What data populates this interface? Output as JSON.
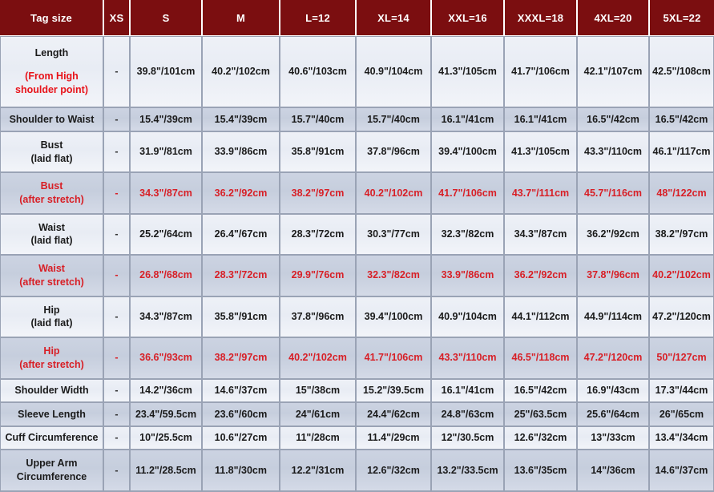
{
  "table": {
    "columns": [
      {
        "key": "label",
        "label": "Tag size"
      },
      {
        "key": "xs",
        "label": "XS"
      },
      {
        "key": "s",
        "label": "S"
      },
      {
        "key": "m",
        "label": "M"
      },
      {
        "key": "l",
        "label": "L=12"
      },
      {
        "key": "xl",
        "label": "XL=14"
      },
      {
        "key": "xxl",
        "label": "XXL=16"
      },
      {
        "key": "xxxl",
        "label": "XXXL=18"
      },
      {
        "key": "xxxxl",
        "label": "4XL=20"
      },
      {
        "key": "xxxxxl",
        "label": "5XL=22"
      }
    ],
    "rows": [
      {
        "label_main": "Length",
        "label_sub": "(From High shoulder point)",
        "label_sub_red": true,
        "stretch": false,
        "band": "light",
        "values": [
          "-",
          "39.8\"/101cm",
          "40.2\"/102cm",
          "40.6\"/103cm",
          "40.9\"/104cm",
          "41.3\"/105cm",
          "41.7\"/106cm",
          "42.1\"/107cm",
          "42.5\"/108cm"
        ]
      },
      {
        "label_main": "Shoulder to Waist",
        "label_sub": "",
        "label_sub_red": false,
        "stretch": false,
        "band": "dark",
        "values": [
          "-",
          "15.4\"/39cm",
          "15.4\"/39cm",
          "15.7\"/40cm",
          "15.7\"/40cm",
          "16.1\"/41cm",
          "16.1\"/41cm",
          "16.5\"/42cm",
          "16.5\"/42cm"
        ]
      },
      {
        "label_main": "Bust",
        "label_sub": "(laid flat)",
        "label_sub_red": false,
        "stretch": false,
        "band": "light",
        "values": [
          "-",
          "31.9\"/81cm",
          "33.9\"/86cm",
          "35.8\"/91cm",
          "37.8\"/96cm",
          "39.4\"/100cm",
          "41.3\"/105cm",
          "43.3\"/110cm",
          "46.1\"/117cm"
        ]
      },
      {
        "label_main": "Bust",
        "label_sub": "(after stretch)",
        "label_sub_red": true,
        "stretch": true,
        "band": "dark",
        "values": [
          "-",
          "34.3\"/87cm",
          "36.2\"/92cm",
          "38.2\"/97cm",
          "40.2\"/102cm",
          "41.7\"/106cm",
          "43.7\"/111cm",
          "45.7\"/116cm",
          "48\"/122cm"
        ]
      },
      {
        "label_main": "Waist",
        "label_sub": "(laid flat)",
        "label_sub_red": false,
        "stretch": false,
        "band": "light",
        "values": [
          "-",
          "25.2\"/64cm",
          "26.4\"/67cm",
          "28.3\"/72cm",
          "30.3\"/77cm",
          "32.3\"/82cm",
          "34.3\"/87cm",
          "36.2\"/92cm",
          "38.2\"/97cm"
        ]
      },
      {
        "label_main": "Waist",
        "label_sub": "(after stretch)",
        "label_sub_red": true,
        "stretch": true,
        "band": "dark",
        "values": [
          "-",
          "26.8\"/68cm",
          "28.3\"/72cm",
          "29.9\"/76cm",
          "32.3\"/82cm",
          "33.9\"/86cm",
          "36.2\"/92cm",
          "37.8\"/96cm",
          "40.2\"/102cm"
        ]
      },
      {
        "label_main": "Hip",
        "label_sub": "(laid flat)",
        "label_sub_red": false,
        "stretch": false,
        "band": "light",
        "values": [
          "-",
          "34.3\"/87cm",
          "35.8\"/91cm",
          "37.8\"/96cm",
          "39.4\"/100cm",
          "40.9\"/104cm",
          "44.1\"/112cm",
          "44.9\"/114cm",
          "47.2\"/120cm"
        ]
      },
      {
        "label_main": "Hip",
        "label_sub": "(after stretch)",
        "label_sub_red": true,
        "stretch": true,
        "band": "dark",
        "values": [
          "-",
          "36.6\"/93cm",
          "38.2\"/97cm",
          "40.2\"/102cm",
          "41.7\"/106cm",
          "43.3\"/110cm",
          "46.5\"/118cm",
          "47.2\"/120cm",
          "50\"/127cm"
        ]
      },
      {
        "label_main": "Shoulder Width",
        "label_sub": "",
        "label_sub_red": false,
        "stretch": false,
        "band": "light",
        "values": [
          "-",
          "14.2\"/36cm",
          "14.6\"/37cm",
          "15\"/38cm",
          "15.2\"/39.5cm",
          "16.1\"/41cm",
          "16.5\"/42cm",
          "16.9\"/43cm",
          "17.3\"/44cm"
        ]
      },
      {
        "label_main": "Sleeve Length",
        "label_sub": "",
        "label_sub_red": false,
        "stretch": false,
        "band": "dark",
        "values": [
          "-",
          "23.4\"/59.5cm",
          "23.6\"/60cm",
          "24\"/61cm",
          "24.4\"/62cm",
          "24.8\"/63cm",
          "25\"/63.5cm",
          "25.6\"/64cm",
          "26\"/65cm"
        ]
      },
      {
        "label_main": "Cuff Circumference",
        "label_sub": "",
        "label_sub_red": false,
        "stretch": false,
        "band": "light",
        "values": [
          "-",
          "10\"/25.5cm",
          "10.6\"/27cm",
          "11\"/28cm",
          "11.4\"/29cm",
          "12\"/30.5cm",
          "12.6\"/32cm",
          "13\"/33cm",
          "13.4\"/34cm"
        ]
      },
      {
        "label_main": "Upper Arm",
        "label_sub": "Circumference",
        "label_sub_red": false,
        "stretch": false,
        "band": "dark",
        "values": [
          "-",
          "11.2\"/28.5cm",
          "11.8\"/30cm",
          "12.2\"/31cm",
          "12.6\"/32cm",
          "13.2\"/33.5cm",
          "13.6\"/35cm",
          "14\"/36cm",
          "14.6\"/37cm"
        ]
      }
    ]
  },
  "colors": {
    "header_bg": "#7b0e10",
    "header_text": "#ffffff",
    "band_light": "#eef1f7",
    "band_dark": "#ccd3e2",
    "border": "#9aa3b5",
    "text": "#1a1a1a",
    "red_text": "#d81f26",
    "red_note": "#e8131a"
  }
}
